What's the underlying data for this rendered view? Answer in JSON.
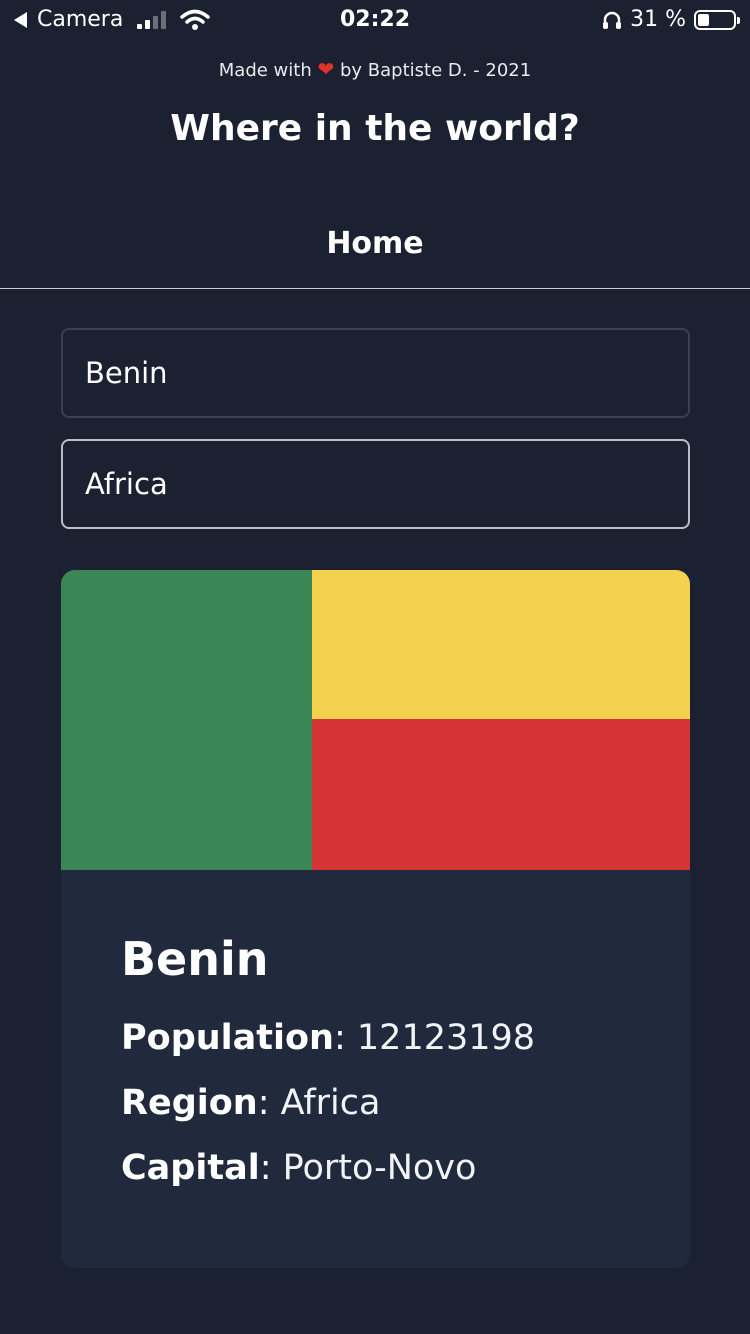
{
  "status_bar": {
    "back_app": "Camera",
    "time": "02:22",
    "battery_percent": "31 %",
    "battery_level": 0.31
  },
  "header": {
    "credit_prefix": "Made with",
    "credit_suffix": "by Baptiste D. - 2021",
    "title": "Where in the world?",
    "nav_home": "Home"
  },
  "search": {
    "value": "Benin"
  },
  "region_filter": {
    "value": "Africa"
  },
  "card": {
    "flag_colors": {
      "green": "#3a8755",
      "yellow": "#f3d24f",
      "red": "#d63337"
    },
    "name": "Benin",
    "population_label": "Population",
    "population_value": "12123198",
    "region_label": "Region",
    "region_value": "Africa",
    "capital_label": "Capital",
    "capital_value": "Porto-Novo"
  },
  "icons": [
    "back-icon",
    "signal-icon",
    "wifi-icon",
    "heart-icon",
    "headphones-icon",
    "battery-icon"
  ]
}
